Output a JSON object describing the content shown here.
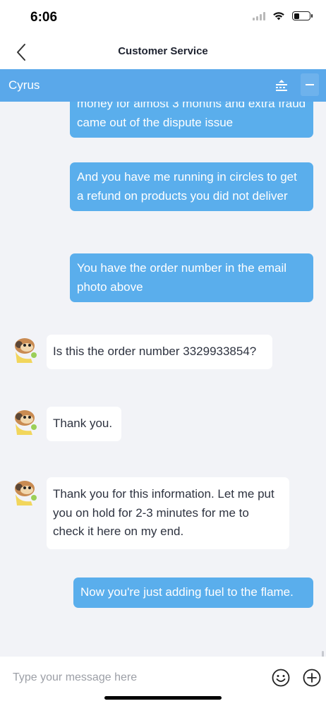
{
  "status_bar": {
    "time": "6:06"
  },
  "header": {
    "title": "Customer Service"
  },
  "agent_bar": {
    "name": "Cyrus"
  },
  "messages": [
    {
      "sender": "user",
      "text": "money for almost 3 months and extra fraud came out of the dispute issue"
    },
    {
      "sender": "user",
      "text": "And you have me running in circles to get a refund on products you did not deliver"
    },
    {
      "sender": "user",
      "text": "You have the order number in the email photo above"
    },
    {
      "sender": "agent",
      "text": "Is this the order number 3329933854?"
    },
    {
      "sender": "agent",
      "text": "Thank you."
    },
    {
      "sender": "agent",
      "text": "Thank you for this information. Let me put you on hold for 2-3 minutes for me to check it here on my end."
    },
    {
      "sender": "user",
      "text": "Now you're just adding fuel to the flame."
    }
  ],
  "composer": {
    "placeholder": "Type your message here"
  },
  "colors": {
    "accent": "#5aa8ea",
    "user_bubble": "#5aaeec",
    "agent_bubble": "#ffffff",
    "background": "#f2f3f7"
  },
  "icons": [
    "back-chevron-icon",
    "transfer-icon",
    "minimize-icon",
    "emoji-icon",
    "plus-circle-icon",
    "agent-avatar-icon",
    "wifi-icon",
    "battery-icon",
    "signal-icon"
  ]
}
